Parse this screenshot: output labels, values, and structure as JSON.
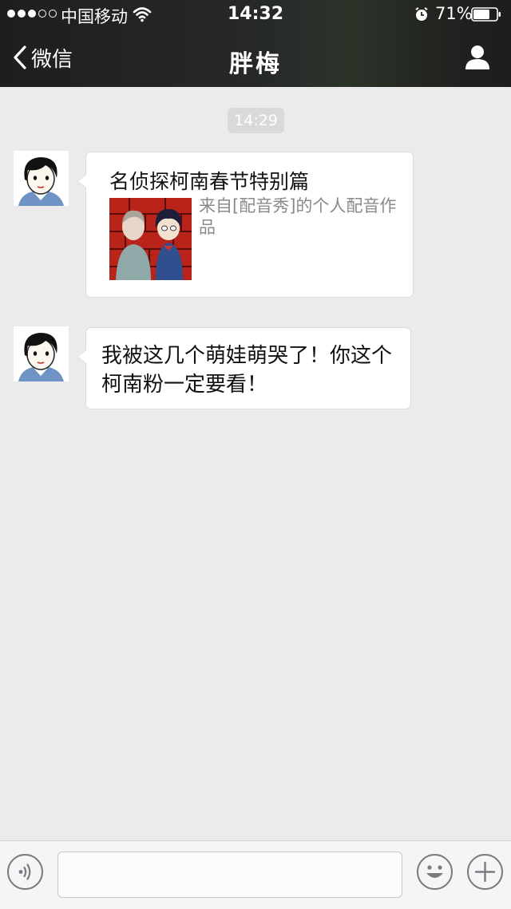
{
  "status_bar": {
    "carrier": "中国移动",
    "time": "14:32",
    "battery_percent": "71%",
    "battery_level": 0.71,
    "signal_bars_filled": 3,
    "signal_bars_total": 5
  },
  "header": {
    "back_label": "微信",
    "title": "胖梅"
  },
  "messages": {
    "timestamp": "14:29",
    "link_card": {
      "title": "名侦探柯南春节特别篇",
      "description": "来自[配音秀]的个人配音作品"
    },
    "text": "我被这几个萌娃萌哭了！你这个柯南粉一定要看！"
  },
  "input_bar": {
    "value": "",
    "placeholder": ""
  },
  "colors": {
    "header_bg": "#26282a",
    "chat_bg": "#ebebeb",
    "bubble_bg": "#ffffff",
    "thumb_red": "#b8231a"
  },
  "icons": [
    "wifi-icon",
    "alarm-icon",
    "battery-icon",
    "back-chevron-icon",
    "contact-icon",
    "voice-icon",
    "emoji-icon",
    "plus-icon"
  ]
}
